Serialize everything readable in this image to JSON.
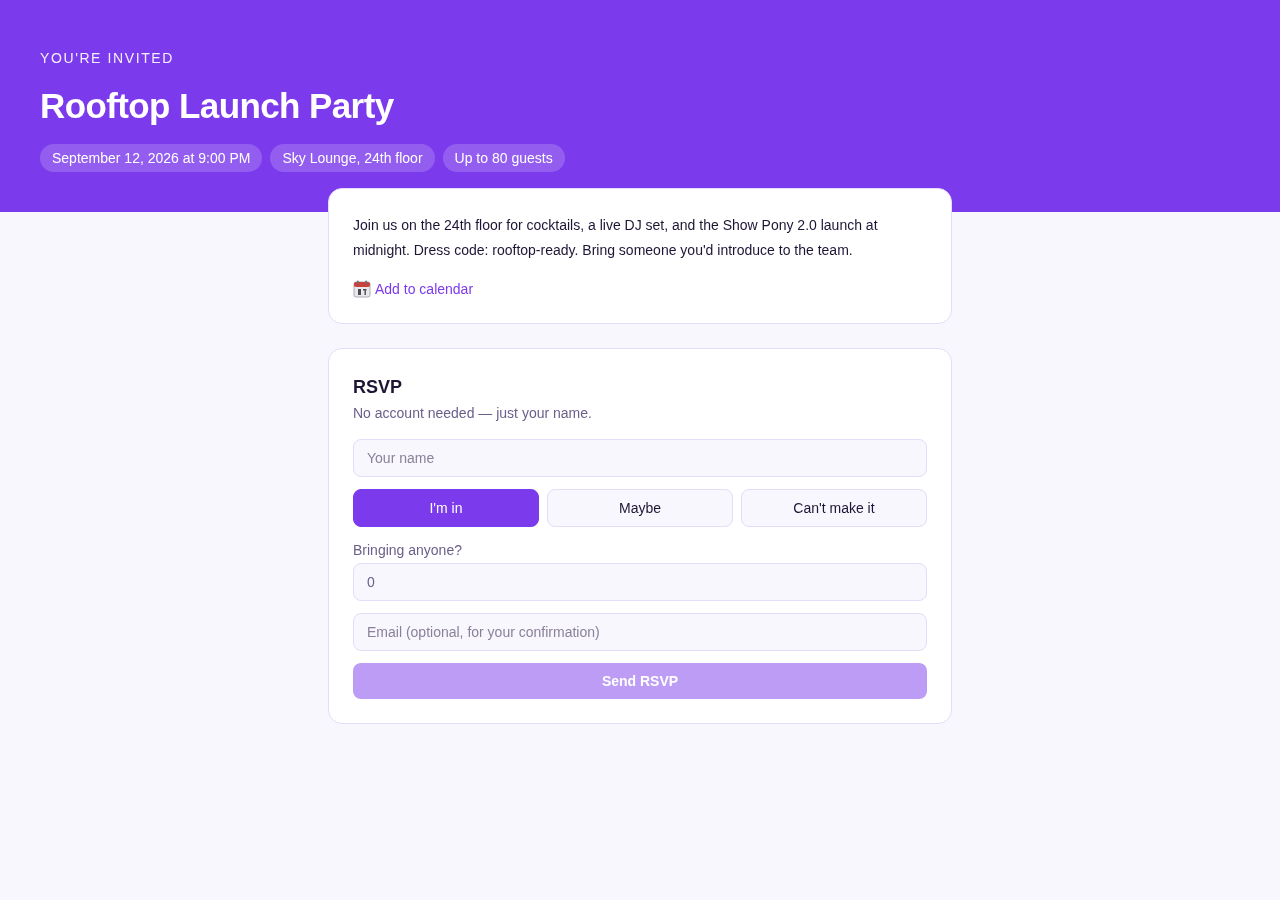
{
  "header": {
    "eyebrow": "YOU'RE INVITED",
    "title": "Rooftop Launch Party",
    "chips": [
      "September 12, 2026 at 9:00 PM",
      "Sky Lounge, 24th floor",
      "Up to 80 guests"
    ]
  },
  "details": {
    "description": "Join us on the 24th floor for cocktails, a live DJ set, and the Show Pony 2.0 launch at midnight. Dress code: rooftop-ready. Bring someone you'd introduce to the team.",
    "calendar_link": "Add to calendar"
  },
  "rsvp": {
    "title": "RSVP",
    "subtitle": "No account needed — just your name.",
    "name_field": {
      "placeholder": "Your name"
    },
    "responses": [
      {
        "label": "I'm in",
        "selected": true
      },
      {
        "label": "Maybe",
        "selected": false
      },
      {
        "label": "Can't make it",
        "selected": false
      }
    ],
    "guests_label": "Bringing anyone?",
    "guests_field": {
      "value": "0"
    },
    "email_field": {
      "placeholder": "Email (optional, for your confirmation)"
    },
    "submit": {
      "label": "Send RSVP",
      "disabled": true
    }
  }
}
